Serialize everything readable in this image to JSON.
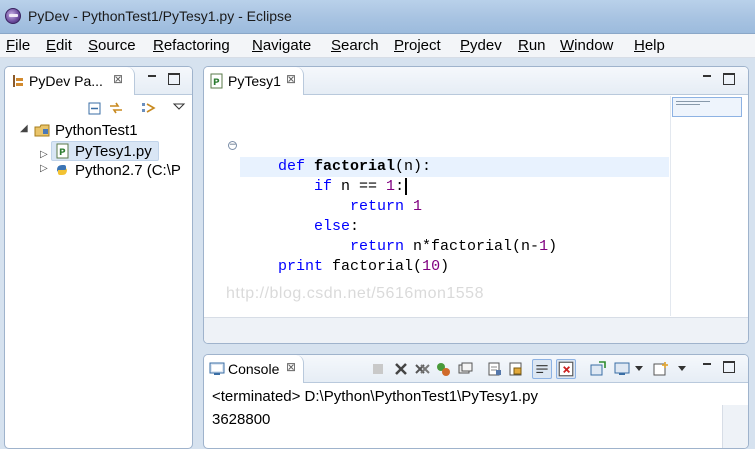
{
  "window": {
    "title": "PyDev - PythonTest1/PyTesy1.py - Eclipse"
  },
  "menu": [
    {
      "label": "File"
    },
    {
      "label": "Edit"
    },
    {
      "label": "Source"
    },
    {
      "label": "Refactoring"
    },
    {
      "label": "Navigate"
    },
    {
      "label": "Search"
    },
    {
      "label": "Project"
    },
    {
      "label": "Pydev"
    },
    {
      "label": "Run"
    },
    {
      "label": "Window"
    },
    {
      "label": "Help"
    }
  ],
  "explorer": {
    "tab_label": "PyDev Pa...",
    "close_symbol": "⊠",
    "tree": [
      {
        "label": "PythonTest1",
        "expanded": true,
        "icon": "project-icon"
      },
      {
        "label": "PyTesy1.py",
        "icon": "python-file-icon",
        "selected": true
      },
      {
        "label": "Python2.7  (C:\\P",
        "icon": "python-interpreter-icon"
      }
    ],
    "colors": {
      "selection": "#d9e6f5"
    }
  },
  "editor": {
    "tab_label": "PyTesy1",
    "close_symbol": "⊠",
    "watermark": "http://blog.csdn.net/5616mon1558",
    "code": [
      {
        "text_def": "def ",
        "text_name": "factorial",
        "text_rest": "(n):"
      },
      {
        "text_if": "if",
        "text_cond": " n == ",
        "text_num": "1",
        "text_colon": ":"
      },
      {
        "text_ret": "return",
        "text_val": " 1"
      },
      {
        "text_else": "else",
        "text_colon": ":"
      },
      {
        "text_ret": "return",
        "text_expr": " n*factorial(n-",
        "text_num": "1",
        "text_close": ")"
      },
      {
        "text_print": "print",
        "text_call": " factorial(",
        "text_num": "10",
        "text_close": ")"
      }
    ],
    "colors": {
      "keyword": "#0000ff",
      "number": "#800080",
      "current_line": "#e8f2fe"
    }
  },
  "console": {
    "tab_label": "Console",
    "close_symbol": "⊠",
    "status": "<terminated> D:\\Python\\PythonTest1\\PyTesy1.py",
    "output": "3628800"
  }
}
